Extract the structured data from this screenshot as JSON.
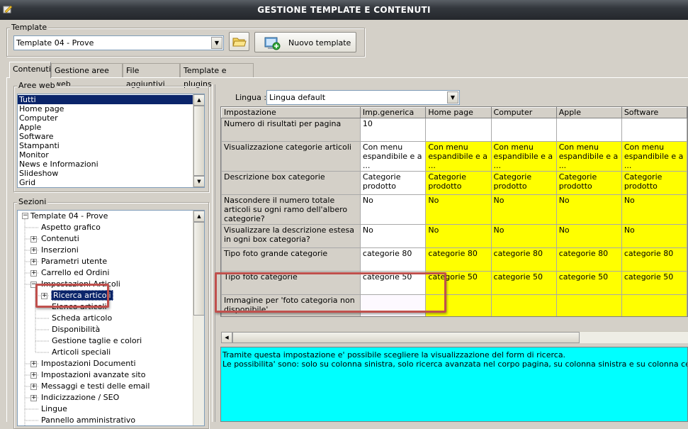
{
  "window": {
    "title": "GESTIONE TEMPLATE E CONTENUTI"
  },
  "template": {
    "group_label": "Template",
    "selected": "Template 04 - Prove",
    "new_button": "Nuovo template"
  },
  "tabs": [
    {
      "label": "Contenuti",
      "active": true
    },
    {
      "label": "Gestione aree web",
      "active": false
    },
    {
      "label": "File aggiuntivi",
      "active": false
    },
    {
      "label": "Template e plugins",
      "active": false
    }
  ],
  "aree_web": {
    "label": "Aree web",
    "items": [
      "Tutti",
      "Home page",
      "Computer",
      "Apple",
      "Software",
      "Stampanti",
      "Monitor",
      "News e Informazioni",
      "Slideshow",
      "Grid"
    ],
    "selected_index": 0
  },
  "sezioni": {
    "label": "Sezioni",
    "tree": [
      {
        "label": "Template 04 - Prove",
        "expander": "−"
      },
      {
        "label": "Aspetto grafico",
        "expander": ""
      },
      {
        "label": "Contenuti",
        "expander": "+"
      },
      {
        "label": "Inserzioni",
        "expander": "+"
      },
      {
        "label": "Parametri utente",
        "expander": "+"
      },
      {
        "label": "Carrello ed Ordini",
        "expander": "+"
      },
      {
        "label": "Impostazioni Articoli",
        "expander": "−"
      },
      {
        "label": "Ricerca articoli",
        "expander": "+"
      },
      {
        "label": "Elenco articoli",
        "expander": ""
      },
      {
        "label": "Scheda articolo",
        "expander": ""
      },
      {
        "label": "Disponibilità",
        "expander": ""
      },
      {
        "label": "Gestione taglie e colori",
        "expander": ""
      },
      {
        "label": "Articoli speciali",
        "expander": ""
      },
      {
        "label": "Impostazioni Documenti",
        "expander": "+"
      },
      {
        "label": "Impostazioni avanzate sito",
        "expander": "+"
      },
      {
        "label": "Messaggi e testi delle email",
        "expander": "+"
      },
      {
        "label": "Indicizzazione / SEO",
        "expander": "+"
      },
      {
        "label": "Lingue",
        "expander": ""
      },
      {
        "label": "Pannello amministrativo",
        "expander": ""
      }
    ]
  },
  "lingua": {
    "label": "Lingua :",
    "selected": "Lingua default"
  },
  "grid": {
    "headers": [
      "Impostazione",
      "Imp.generica",
      "Home page",
      "Computer",
      "Apple",
      "Software"
    ],
    "rows": [
      {
        "label": "Numero di risultati per pagina",
        "generic": "10",
        "areas": [
          "",
          "",
          "",
          ""
        ]
      },
      {
        "label": "Visualizzazione categorie articoli",
        "generic": "Con menu espandibile e a ...",
        "areas": [
          "Con menu espandibile e a ...",
          "Con menu espandibile e a ...",
          "Con menu espandibile e a ...",
          "Con menu espandibile e a ..."
        ]
      },
      {
        "label": "Descrizione box categorie",
        "generic": "Categorie prodotto",
        "areas": [
          "Categorie prodotto",
          "Categorie prodotto",
          "Categorie prodotto",
          "Categorie prodotto"
        ]
      },
      {
        "label": "Nascondere il numero totale articoli su ogni ramo dell'albero categorie?",
        "generic": "No",
        "areas": [
          "No",
          "No",
          "No",
          "No"
        ]
      },
      {
        "label": "Visualizzare la descrizione estesa in ogni box categoria?",
        "generic": "No",
        "areas": [
          "No",
          "No",
          "No",
          "No"
        ]
      },
      {
        "label": "Tipo foto grande categorie",
        "generic": "categorie 80",
        "areas": [
          "categorie 80",
          "categorie 80",
          "categorie 80",
          "categorie 80"
        ]
      },
      {
        "label": "Tipo foto categorie",
        "generic": "categorie 50",
        "areas": [
          "categorie 50",
          "categorie 50",
          "categorie 50",
          "categorie 50"
        ]
      },
      {
        "label": "Immagine per 'foto categoria non disponibile'",
        "generic": "",
        "areas": [
          "",
          "",
          "",
          ""
        ]
      },
      {
        "label": "",
        "generic": "",
        "areas": [
          "",
          "",
          "",
          ""
        ]
      }
    ]
  },
  "description": {
    "line1": "Tramite questa impostazione e' possibile scegliere la visualizzazione del form di ricerca.",
    "line2": "Le possibilita' sono: solo su colonna sinistra, solo ricerca avanzata nel corpo pagina, su colonna sinistra e su colonna centrale, non visibile."
  },
  "colors": {
    "highlight_yellow": "#ffff00",
    "description_cyan": "#00ffff",
    "annotation_red": "#c0504d",
    "selection_blue": "#0a246a"
  },
  "icons": [
    "app-icon",
    "folder-open-icon",
    "new-template-icon",
    "combo-arrow-icon",
    "scroll-up-icon",
    "scroll-down-icon",
    "scroll-left-icon"
  ]
}
